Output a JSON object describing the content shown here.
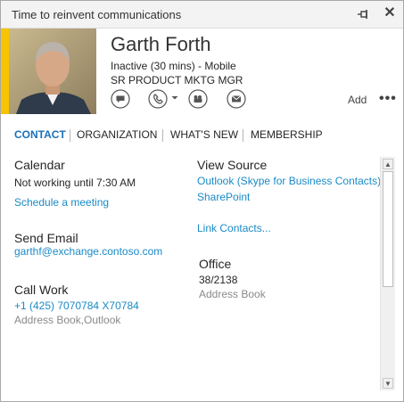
{
  "window": {
    "title": "Time to reinvent communications"
  },
  "contact": {
    "name": "Garth Forth",
    "status": "Inactive (30 mins) - Mobile",
    "job_title": "SR PRODUCT MKTG MGR",
    "presence_color": "#f8c400"
  },
  "actions": {
    "add_label": "Add",
    "more_label": "•••",
    "icons": [
      "im-icon",
      "phone-icon",
      "video-icon",
      "email-icon"
    ]
  },
  "tabs": [
    {
      "label": "CONTACT",
      "active": true
    },
    {
      "label": "ORGANIZATION",
      "active": false
    },
    {
      "label": "WHAT'S NEW",
      "active": false
    },
    {
      "label": "MEMBERSHIP",
      "active": false
    }
  ],
  "calendar": {
    "heading": "Calendar",
    "status": "Not working until 7:30 AM",
    "link": "Schedule a meeting"
  },
  "email": {
    "heading": "Send Email",
    "address": "garthf@exchange.contoso.com"
  },
  "call": {
    "heading": "Call Work",
    "number": "+1 (425) 7070784 X70784",
    "source": "Address Book,Outlook"
  },
  "view_source": {
    "heading": "View Source",
    "link1": "Outlook (Skype for Business Contacts)",
    "link2": "SharePoint",
    "link3": "Link Contacts..."
  },
  "office": {
    "heading": "Office",
    "value": "38/2138",
    "source": "Address Book"
  },
  "colors": {
    "accent": "#1a70b8",
    "link": "#1a8ac6",
    "muted": "#8a8a8a"
  }
}
